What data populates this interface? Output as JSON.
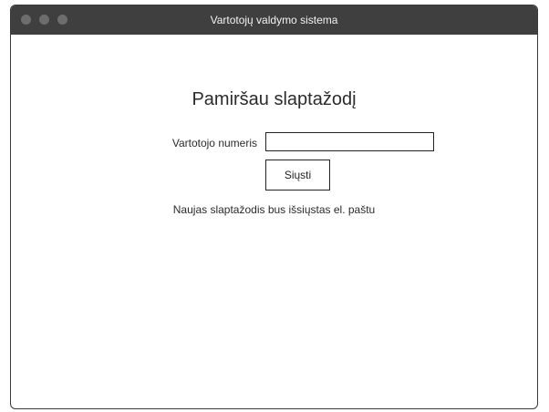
{
  "window": {
    "title": "Vartotojų valdymo sistema"
  },
  "form": {
    "heading": "Pamiršau slaptažodį",
    "username_label": "Vartotojo numeris",
    "username_value": "",
    "username_placeholder": "",
    "submit_label": "Siųsti",
    "info_text": "Naujas slaptažodis bus išsiųstas el. paštu"
  },
  "colors": {
    "titlebar": "#3f3f3f",
    "window_dot": "#6d6d6d",
    "border": "#222222"
  }
}
